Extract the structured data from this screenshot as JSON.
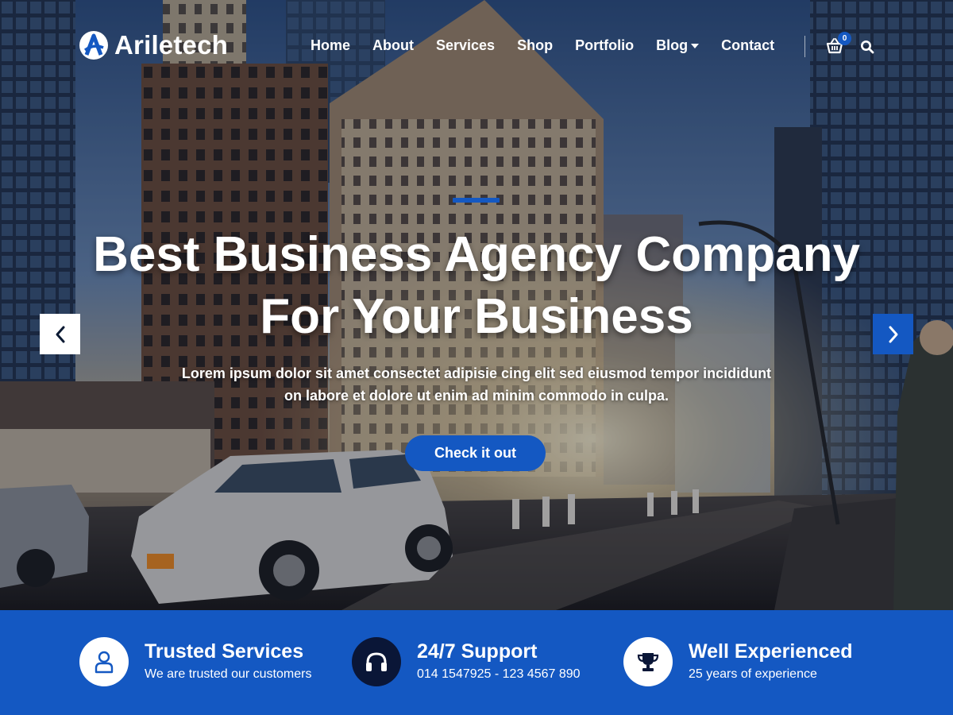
{
  "brand": {
    "name": "Ariletech",
    "logo_icon": "logo-a-icon"
  },
  "nav": {
    "items": [
      {
        "label": "Home"
      },
      {
        "label": "About"
      },
      {
        "label": "Services"
      },
      {
        "label": "Shop"
      },
      {
        "label": "Portfolio"
      },
      {
        "label": "Blog",
        "has_dropdown": true
      },
      {
        "label": "Contact"
      }
    ],
    "cart_count": "0",
    "cart_icon": "basket-icon",
    "search_icon": "search-icon"
  },
  "hero": {
    "headline_line1": "Best Business Agency Company",
    "headline_line2": "For Your Business",
    "description_line1": "Lorem ipsum dolor sit amet consectet adipisie cing elit sed eiusmod tempor incididunt",
    "description_line2": "on labore et dolore ut enim ad minim commodo in culpa.",
    "cta_label": "Check it out",
    "prev_icon": "chevron-left-icon",
    "next_icon": "chevron-right-icon"
  },
  "features": [
    {
      "title": "Trusted Services",
      "subtitle": "We are trusted our customers",
      "icon": "user-icon"
    },
    {
      "title": "24/7 Support",
      "subtitle": "014 1547925 - 123 4567 890",
      "icon": "headphones-icon"
    },
    {
      "title": "Well Experienced",
      "subtitle": "25 years of experience",
      "icon": "trophy-icon"
    }
  ],
  "colors": {
    "accent": "#1458c2",
    "dark_navy": "#0a1637",
    "white": "#ffffff"
  }
}
